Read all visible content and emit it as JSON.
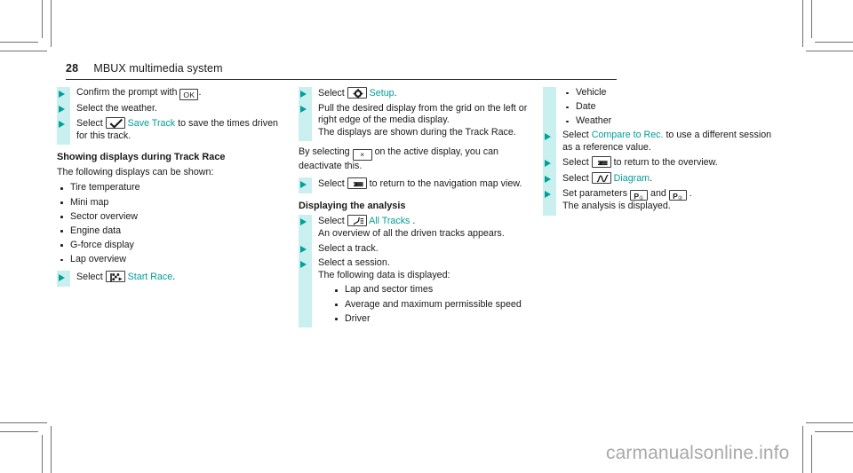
{
  "header": {
    "page_number": "28",
    "title": "MBUX multimedia system"
  },
  "columns": {
    "left": {
      "steps_group1": [
        {
          "prefix": "Confirm the prompt with ",
          "icon": "ok-key-icon",
          "icon_label": "OK",
          "suffix": "."
        },
        {
          "prefix": "Select the weather.",
          "icon": null,
          "icon_label": "",
          "suffix": ""
        },
        {
          "prefix": "Select ",
          "icon": "checkmark-icon",
          "icon_label": "",
          "link": "Save Track",
          "suffix": " to save the times driven for this track."
        }
      ],
      "subheading": "Showing displays during Track Race",
      "intro": "The following displays can be shown:",
      "bullets": [
        "Tire temperature",
        "Mini map",
        "Sector overview",
        "Engine data",
        "G-force display",
        "Lap overview"
      ],
      "final_step": {
        "prefix": "Select ",
        "icon": "checkered-flag-icon",
        "link": "Start Race",
        "suffix": "."
      }
    },
    "middle": {
      "steps_group1": [
        {
          "prefix": "Select ",
          "icon": "gear-icon",
          "link": "Setup",
          "suffix": "."
        },
        {
          "prefix": "Pull the desired display from the grid on the left or right edge of the media display.",
          "line2": "The displays are shown during the Track Race.",
          "icon": null
        }
      ],
      "paragraph": {
        "part1": "By selecting ",
        "icon": "close-x-icon",
        "icon_label": "×",
        "part2": " on the active display, you can deactivate this."
      },
      "steps_group2": [
        {
          "prefix": "Select ",
          "icon": "back-arrow-icon",
          "suffix": " to return to the navigation map view."
        }
      ],
      "subheading": "Displaying the analysis",
      "steps_group3": [
        {
          "prefix": "Select ",
          "icon": "all-tracks-icon",
          "link": "All Tracks",
          "suffix": " .",
          "note": "An overview of all the driven tracks appears."
        },
        {
          "prefix": "Select a track.",
          "icon": null
        },
        {
          "prefix": "Select a session.",
          "icon": null,
          "note": "The following data is displayed:"
        }
      ],
      "nested_bullets": [
        "Lap and sector times",
        "Average and maximum permissible speed",
        "Driver"
      ]
    },
    "right": {
      "bullets": [
        "Vehicle",
        "Date",
        "Weather"
      ],
      "steps": [
        {
          "prefix": "Select ",
          "icon": null,
          "link": "Compare to Rec.",
          "suffix": " to use a different session as a reference value."
        },
        {
          "prefix": "Select ",
          "icon": "back-arrow-icon",
          "suffix": " to return to the overview."
        },
        {
          "prefix": "Select ",
          "icon": "diagram-icon",
          "link": "Diagram",
          "suffix": "."
        },
        {
          "prefix": "Set parameters ",
          "icon": "param-p1-icon",
          "icon_label": "P",
          "icon_sub1": "①",
          "middle": " and ",
          "icon2": "param-p2-icon",
          "icon2_sub": "②",
          "suffix": " .",
          "note": "The analysis is displayed."
        }
      ]
    }
  },
  "watermark": "carmanualsonline.info",
  "colors": {
    "accent_teal": "#00a19a",
    "link_teal": "#009c99",
    "highlight_cyan": "#c9f0ee",
    "text": "#1a1a1a",
    "watermark_gray": "#a9a9a9"
  }
}
